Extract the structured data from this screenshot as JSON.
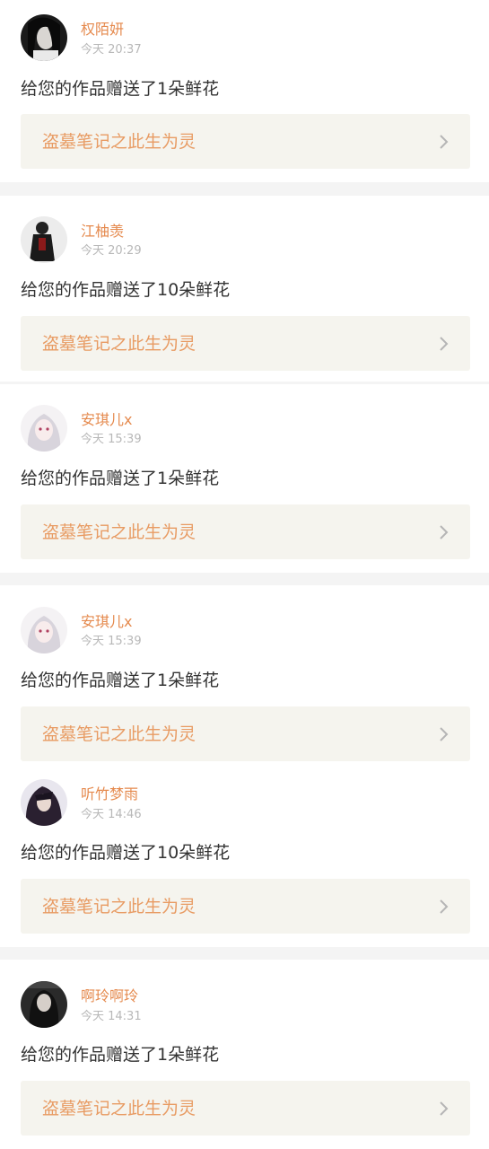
{
  "notifications": [
    {
      "user": "权陌妍",
      "time": "今天 20:37",
      "message": "给您的作品赠送了1朵鲜花",
      "work": "盗墓笔记之此生为灵",
      "avatar": "avatar-dark-girl"
    },
    {
      "user": "江柚羡",
      "time": "今天 20:29",
      "message": "给您的作品赠送了10朵鲜花",
      "work": "盗墓笔记之此生为灵",
      "avatar": "avatar-dark-figure"
    },
    {
      "user": "安琪儿x",
      "time": "今天 15:39",
      "message": "给您的作品赠送了1朵鲜花",
      "work": "盗墓笔记之此生为灵",
      "avatar": "avatar-white-hair-anime"
    },
    {
      "user": "安琪儿x",
      "time": "今天 15:39",
      "message": "给您的作品赠送了1朵鲜花",
      "work": "盗墓笔记之此生为灵",
      "avatar": "avatar-white-hair-anime"
    },
    {
      "user": "听竹梦雨",
      "time": "今天 14:46",
      "message": "给您的作品赠送了10朵鲜花",
      "work": "盗墓笔记之此生为灵",
      "avatar": "avatar-dark-anime"
    },
    {
      "user": "啊玲啊玲",
      "time": "今天 14:31",
      "message": "给您的作品赠送了1朵鲜花",
      "work": "盗墓笔记之此生为灵",
      "avatar": "avatar-dark-portrait"
    }
  ],
  "colors": {
    "username": "#e58a4e",
    "work_title": "#e89b63",
    "work_bg": "#f5f4ee",
    "separator": "#f4f4f4"
  }
}
